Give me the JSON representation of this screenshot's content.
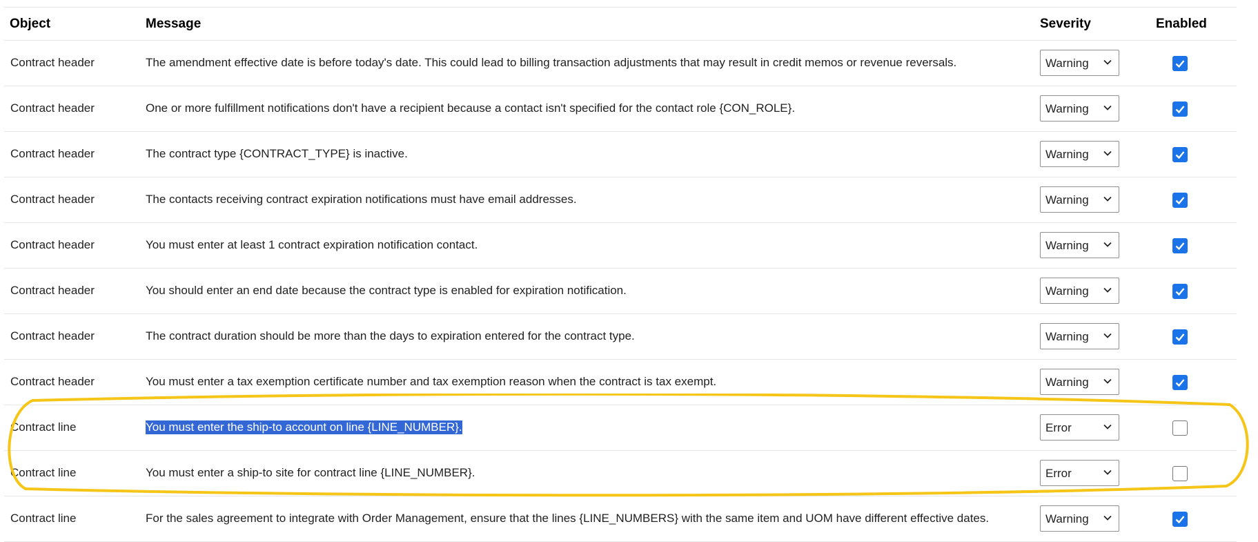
{
  "columns": {
    "object": "Object",
    "message": "Message",
    "severity": "Severity",
    "enabled": "Enabled"
  },
  "rows": [
    {
      "object": "Contract header",
      "message": "The amendment effective date is before today's date. This could lead to billing transaction adjustments that may result in credit memos or revenue reversals.",
      "severity": "Warning",
      "enabled": true
    },
    {
      "object": "Contract header",
      "message": "One or more fulfillment notifications don't have a recipient because a contact isn't specified for the contact role {CON_ROLE}.",
      "severity": "Warning",
      "enabled": true
    },
    {
      "object": "Contract header",
      "message": "The contract type {CONTRACT_TYPE} is inactive.",
      "severity": "Warning",
      "enabled": true
    },
    {
      "object": "Contract header",
      "message": "The contacts receiving contract expiration notifications must have email addresses.",
      "severity": "Warning",
      "enabled": true
    },
    {
      "object": "Contract header",
      "message": "You must enter at least 1 contract expiration notification contact.",
      "severity": "Warning",
      "enabled": true
    },
    {
      "object": "Contract header",
      "message": "You should enter an end date because the contract type is enabled for expiration notification.",
      "severity": "Warning",
      "enabled": true
    },
    {
      "object": "Contract header",
      "message": "The contract duration should be more than the days to expiration entered for the contract type.",
      "severity": "Warning",
      "enabled": true
    },
    {
      "object": "Contract header",
      "message": "You must enter a tax exemption certificate number and tax exemption reason when the contract is tax exempt.",
      "severity": "Warning",
      "enabled": true
    },
    {
      "object": "Contract line",
      "message": "You must enter the ship-to account on line {LINE_NUMBER}.",
      "severity": "Error",
      "enabled": false,
      "selected": true
    },
    {
      "object": "Contract line",
      "message": "You must enter a ship-to site for contract line {LINE_NUMBER}.",
      "severity": "Error",
      "enabled": false
    },
    {
      "object": "Contract line",
      "message": "For the sales agreement to integrate with Order Management, ensure that the lines {LINE_NUMBERS} with the same item and UOM have different effective dates.",
      "severity": "Warning",
      "enabled": true
    }
  ],
  "colors": {
    "checkbox_checked": "#1a73e8",
    "selection": "#3367d6",
    "highlight_ellipse": "#f5c518"
  },
  "icons": {
    "dropdown": "chevron-down-icon",
    "checked": "checkmark-icon"
  }
}
